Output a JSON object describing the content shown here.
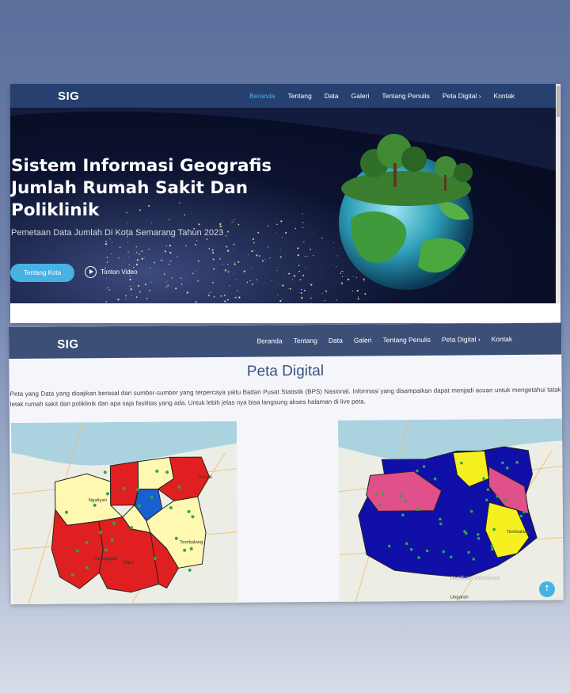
{
  "site": {
    "brand": "SIG",
    "nav": [
      {
        "label": "Beranda"
      },
      {
        "label": "Tentang"
      },
      {
        "label": "Data"
      },
      {
        "label": "Galeri"
      },
      {
        "label": "Tentang Penulis"
      },
      {
        "label": "Peta Digital",
        "chevron": "›"
      },
      {
        "label": "Kontak"
      }
    ]
  },
  "hero": {
    "title": "Sistem Informasi Geografis Jumlah Rumah Sakit Dan Poliklinik",
    "subtitle": "Pemetaan Data Jumlah Di Kota Semarang Tahun 2023",
    "cta": "Tentang Kota",
    "video": "Tonton Video"
  },
  "peta": {
    "title": "Peta Digital",
    "description": "Peta yang Data yang disajikan berasal dari sumber-sumber yang terpercaya yaitu Badan Pusat Statistik (BPS) Nasional. Informasi yang disampaikan dapat menjadi acuan untuk mengetahui tatak letak rumah sakit dan poliklinik dan apa saja fasilitas yang ada. Untuk lebih jelas nya bisa langsung akses halaman di live peta.",
    "left_map_labels": [
      "Ngaliyan",
      "Gunungpati",
      "Mijen",
      "Tembalang",
      "Genuk"
    ],
    "right_map_labels": [
      "Tembalang",
      "Ungaran",
      "Aktifkan Windows"
    ]
  },
  "colors": {
    "nav1": "#26406f",
    "nav2": "#3b4f77",
    "accent": "#47b2e4",
    "map_red": "#e02020",
    "map_yellow": "#fff8b0",
    "map_blue": "#1010a8",
    "map_bright_yellow": "#f6f020",
    "map_pink": "#e0508a"
  }
}
